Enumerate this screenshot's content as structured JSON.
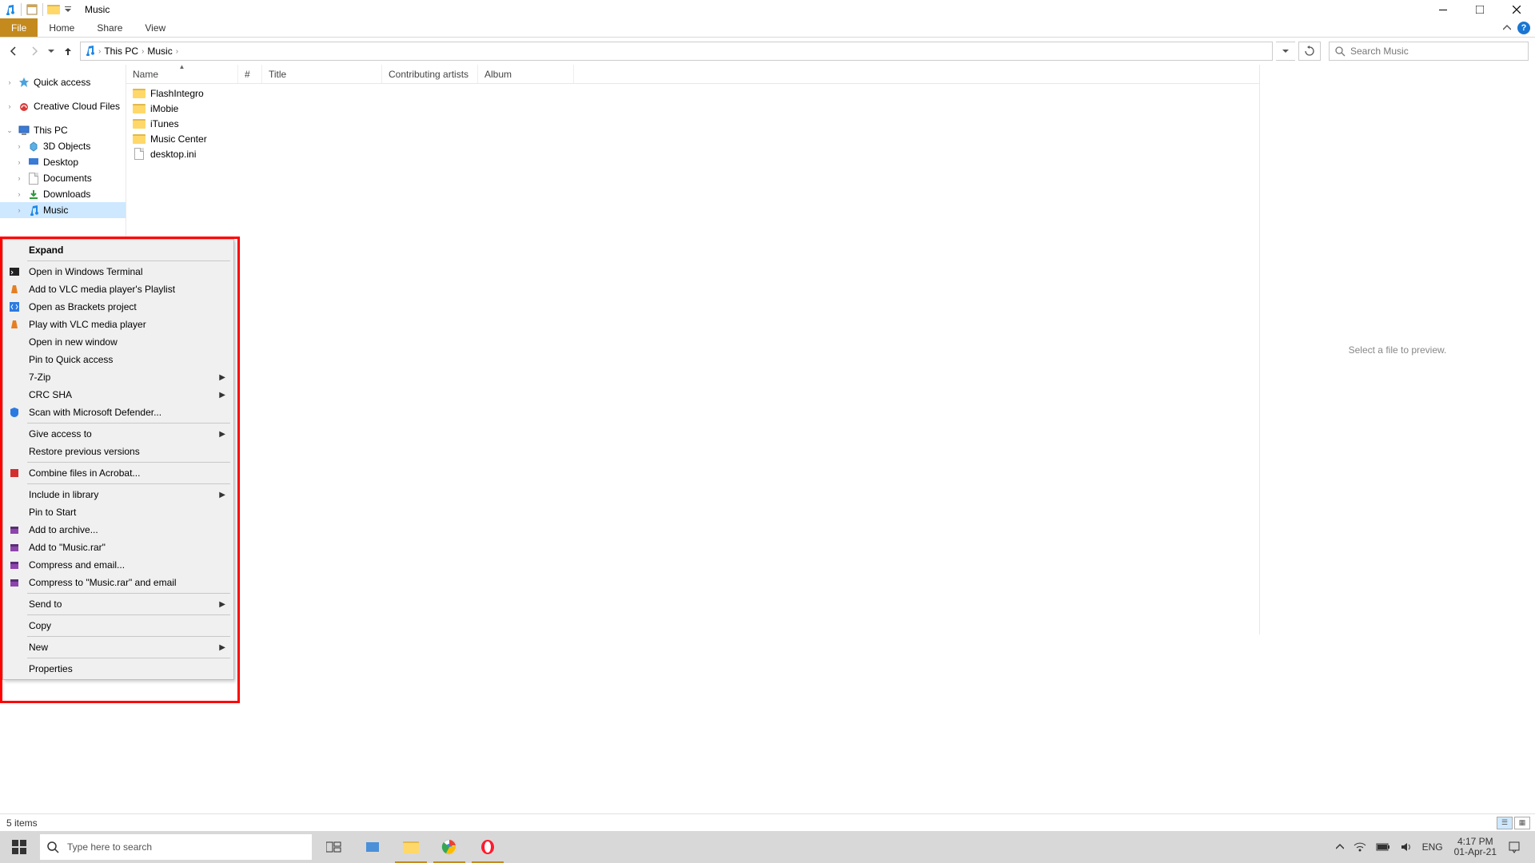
{
  "window": {
    "title": "Music"
  },
  "ribbon": {
    "file": "File",
    "tabs": [
      "Home",
      "Share",
      "View"
    ]
  },
  "nav": {
    "breadcrumbs": [
      "This PC",
      "Music"
    ],
    "search_placeholder": "Search Music"
  },
  "tree": {
    "quickaccess": "Quick access",
    "creativecloud": "Creative Cloud Files",
    "thispc": "This PC",
    "children": [
      "3D Objects",
      "Desktop",
      "Documents",
      "Downloads",
      "Music"
    ]
  },
  "columns": {
    "name": "Name",
    "hash": "#",
    "title": "Title",
    "artist": "Contributing artists",
    "album": "Album"
  },
  "files": [
    {
      "name": "FlashIntegro",
      "type": "folder"
    },
    {
      "name": "iMobie",
      "type": "folder"
    },
    {
      "name": "iTunes",
      "type": "folder"
    },
    {
      "name": "Music Center",
      "type": "folder"
    },
    {
      "name": "desktop.ini",
      "type": "file"
    }
  ],
  "preview": {
    "placeholder": "Select a file to preview."
  },
  "status": {
    "count": "5 items"
  },
  "contextmenu": {
    "expand": "Expand",
    "items1": [
      "Open in Windows Terminal",
      "Add to VLC media player's Playlist",
      "Open as Brackets project",
      "Play with VLC media player",
      "Open in new window",
      "Pin to Quick access"
    ],
    "sevenzip": "7-Zip",
    "crcsha": "CRC SHA",
    "scan": "Scan with Microsoft Defender...",
    "giveaccess": "Give access to",
    "restore": "Restore previous versions",
    "combine": "Combine files in Acrobat...",
    "include": "Include in library",
    "pinstart": "Pin to Start",
    "addarchive": "Add to archive...",
    "addmusicrar": "Add to \"Music.rar\"",
    "compressemail": "Compress and email...",
    "compresstomusic": "Compress to \"Music.rar\" and email",
    "sendto": "Send to",
    "copy": "Copy",
    "new": "New",
    "properties": "Properties"
  },
  "taskbar": {
    "search_placeholder": "Type here to search",
    "lang": "ENG",
    "time": "4:17 PM",
    "date": "01-Apr-21"
  }
}
